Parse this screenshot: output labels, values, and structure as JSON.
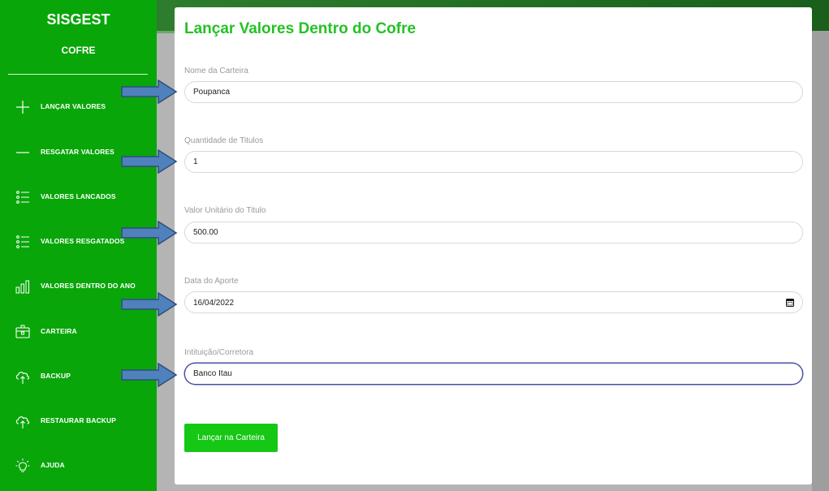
{
  "sidebar": {
    "title": "SISGEST",
    "subtitle": "COFRE",
    "items": [
      {
        "label": "LANÇAR VALORES",
        "icon": "plus-icon"
      },
      {
        "label": "RESGATAR VALORES",
        "icon": "minus-icon"
      },
      {
        "label": "VALORES LANCADOS",
        "icon": "list-icon"
      },
      {
        "label": "VALORES RESGATADOS",
        "icon": "list-icon"
      },
      {
        "label": "VALORES DENTRO DO ANO",
        "icon": "bar-chart-icon"
      },
      {
        "label": "CARTEIRA",
        "icon": "wallet-icon"
      },
      {
        "label": "BACKUP",
        "icon": "cloud-upload-icon"
      },
      {
        "label": "RESTAURAR BACKUP",
        "icon": "cloud-upload-icon"
      },
      {
        "label": "AJUDA",
        "icon": "lightbulb-icon"
      }
    ]
  },
  "form": {
    "title": "Lançar Valores Dentro do Cofre",
    "fields": [
      {
        "label": "Nome da Carteira",
        "value": "Poupanca"
      },
      {
        "label": "Quantidade de Titulos",
        "value": "1"
      },
      {
        "label": "Valor Unitário do Titulo",
        "value": "500.00"
      },
      {
        "label": "Data do Aporte",
        "value": "16/04/2022"
      },
      {
        "label": "Intituição/Corretora",
        "value": "Banco Itau"
      }
    ],
    "submit_label": "Lançar na Carteira"
  },
  "colors": {
    "sidebar": "#09a60a",
    "title": "#25c125",
    "button": "#15c815",
    "arrow_fill": "#4f81bd",
    "arrow_stroke": "#2f4e7a",
    "focus_border": "#4a4fa3"
  }
}
